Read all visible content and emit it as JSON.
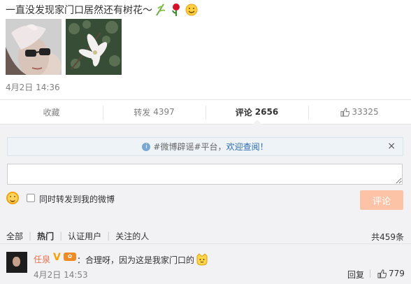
{
  "post": {
    "text": "一直没发现家门口居然还有树花～",
    "time": "4月2日 14:36"
  },
  "actions": {
    "collect": "收藏",
    "repost_label": "转发",
    "repost_count": "4397",
    "comment_label": "评论",
    "comment_count": "2656",
    "like_count": "33325"
  },
  "notice": {
    "prefix": "#微博辟谣#",
    "middle": "平台，",
    "link": "欢迎查阅！",
    "close": "×"
  },
  "composer": {
    "input_value": "",
    "repost_checkbox_label": "同时转发到我的微博",
    "submit_label": "评论"
  },
  "comment_tabs": {
    "all": "全部",
    "hot": "热门",
    "verified": "认证用户",
    "following": "关注的人",
    "total": "共459条"
  },
  "comments": [
    {
      "user": "任泉",
      "text": "：合理呀，因为这是我家门口的",
      "time": "4月2日 14:53",
      "reply_label": "回复",
      "likes": "779"
    }
  ],
  "colors": {
    "link_orange": "#eb7350",
    "submit_bg": "#fdc3a7",
    "comment_bg": "#f2f2f5"
  }
}
